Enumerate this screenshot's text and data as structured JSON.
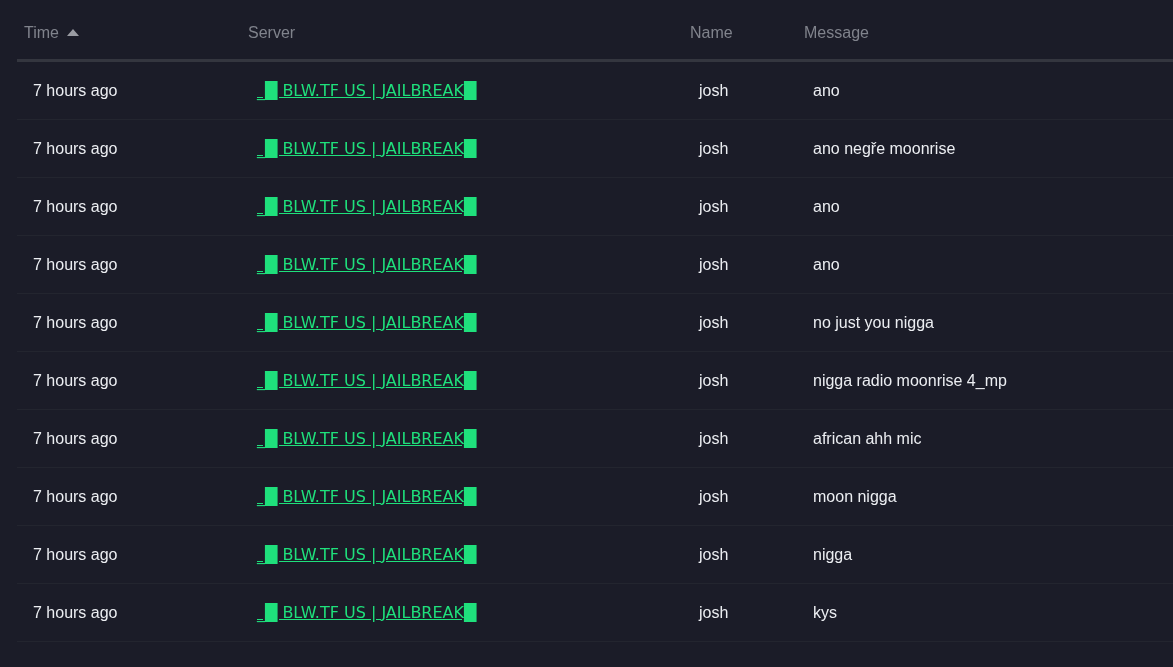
{
  "table": {
    "columns": [
      {
        "label": "Time",
        "sorted": true
      },
      {
        "label": "Server",
        "sorted": false
      },
      {
        "label": "Name",
        "sorted": false
      },
      {
        "label": "Message",
        "sorted": false
      }
    ],
    "rows": [
      {
        "time": "7 hours ago",
        "server": "_█ BLW.TF US | JAILBREAK█",
        "name": "josh",
        "message": "ano"
      },
      {
        "time": "7 hours ago",
        "server": "_█ BLW.TF US | JAILBREAK█",
        "name": "josh",
        "message": "ano negře moonrise"
      },
      {
        "time": "7 hours ago",
        "server": "_█ BLW.TF US | JAILBREAK█",
        "name": "josh",
        "message": "ano"
      },
      {
        "time": "7 hours ago",
        "server": "_█ BLW.TF US | JAILBREAK█",
        "name": "josh",
        "message": "ano"
      },
      {
        "time": "7 hours ago",
        "server": "_█ BLW.TF US | JAILBREAK█",
        "name": "josh",
        "message": "no just you nigga"
      },
      {
        "time": "7 hours ago",
        "server": "_█ BLW.TF US | JAILBREAK█",
        "name": "josh",
        "message": "nigga radio moonrise 4_mp"
      },
      {
        "time": "7 hours ago",
        "server": "_█ BLW.TF US | JAILBREAK█",
        "name": "josh",
        "message": "african ahh mic"
      },
      {
        "time": "7 hours ago",
        "server": "_█ BLW.TF US | JAILBREAK█",
        "name": "josh",
        "message": "moon nigga"
      },
      {
        "time": "7 hours ago",
        "server": "_█ BLW.TF US | JAILBREAK█",
        "name": "josh",
        "message": "nigga"
      },
      {
        "time": "7 hours ago",
        "server": "_█ BLW.TF US | JAILBREAK█",
        "name": "josh",
        "message": "kys"
      }
    ]
  }
}
